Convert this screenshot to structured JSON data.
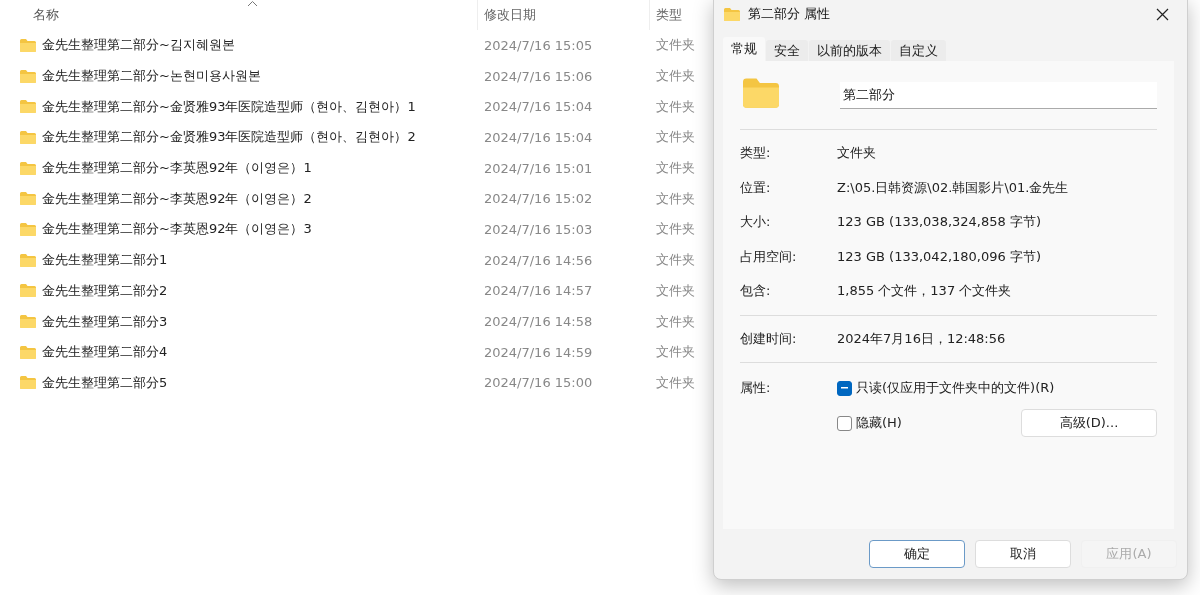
{
  "explorer": {
    "columns": [
      {
        "label": "名称",
        "sorted": true
      },
      {
        "label": "修改日期",
        "sorted": false
      },
      {
        "label": "类型",
        "sorted": false
      }
    ],
    "rows": [
      {
        "name": "金先生整理第二部分~김지혜원본",
        "date": "2024/7/16 15:05",
        "type": "文件夹"
      },
      {
        "name": "金先生整理第二部分~논현미용사원본",
        "date": "2024/7/16 15:06",
        "type": "文件夹"
      },
      {
        "name": "金先生整理第二部分~金贤雅93年医院造型师（현아、김현아）1",
        "date": "2024/7/16 15:04",
        "type": "文件夹"
      },
      {
        "name": "金先生整理第二部分~金贤雅93年医院造型师（현아、김현아）2",
        "date": "2024/7/16 15:04",
        "type": "文件夹"
      },
      {
        "name": "金先生整理第二部分~李英恩92年（이영은）1",
        "date": "2024/7/16 15:01",
        "type": "文件夹"
      },
      {
        "name": "金先生整理第二部分~李英恩92年（이영은）2",
        "date": "2024/7/16 15:02",
        "type": "文件夹"
      },
      {
        "name": "金先生整理第二部分~李英恩92年（이영은）3",
        "date": "2024/7/16 15:03",
        "type": "文件夹"
      },
      {
        "name": "金先生整理第二部分1",
        "date": "2024/7/16 14:56",
        "type": "文件夹"
      },
      {
        "name": "金先生整理第二部分2",
        "date": "2024/7/16 14:57",
        "type": "文件夹"
      },
      {
        "name": "金先生整理第二部分3",
        "date": "2024/7/16 14:58",
        "type": "文件夹"
      },
      {
        "name": "金先生整理第二部分4",
        "date": "2024/7/16 14:59",
        "type": "文件夹"
      },
      {
        "name": "金先生整理第二部分5",
        "date": "2024/7/16 15:00",
        "type": "文件夹"
      }
    ]
  },
  "dialog": {
    "title": "第二部分 属性",
    "tabs": [
      {
        "label": "常规",
        "selected": true
      },
      {
        "label": "安全",
        "selected": false
      },
      {
        "label": "以前的版本",
        "selected": false
      },
      {
        "label": "自定义",
        "selected": false
      }
    ],
    "name_field": {
      "value": "第二部分"
    },
    "groups": [
      [
        {
          "label": "类型:",
          "value": "文件夹"
        },
        {
          "label": "位置:",
          "value": "Z:\\05.日韩资源\\02.韩国影片\\01.金先生"
        },
        {
          "label": "大小:",
          "value": "123 GB (133,038,324,858 字节)"
        },
        {
          "label": "占用空间:",
          "value": "123 GB (133,042,180,096 字节)"
        },
        {
          "label": "包含:",
          "value": "1,855 个文件，137 个文件夹"
        }
      ],
      [
        {
          "label": "创建时间:",
          "value": "2024年7月16日，12:48:56"
        }
      ]
    ],
    "attributes": {
      "label": "属性:",
      "checkboxes": [
        {
          "label": "只读(仅应用于文件夹中的文件)(R)",
          "checked": true,
          "indeterminate": true
        },
        {
          "label": "隐藏(H)",
          "checked": false,
          "indeterminate": false
        }
      ],
      "advanced_button": "高级(D)..."
    },
    "buttons": [
      {
        "label": "确定",
        "kind": "default",
        "disabled": false
      },
      {
        "label": "取消",
        "kind": "normal",
        "disabled": false
      },
      {
        "label": "应用(A)",
        "kind": "normal",
        "disabled": true
      }
    ]
  }
}
